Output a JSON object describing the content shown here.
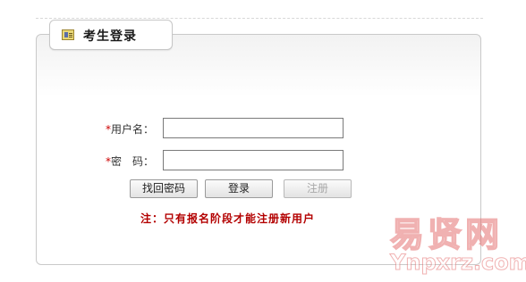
{
  "header": {
    "title": "考生登录",
    "icon": "id-card-icon"
  },
  "form": {
    "username": {
      "required_mark": "*",
      "label": "用户名：",
      "value": ""
    },
    "password": {
      "required_mark": "*",
      "label": "密　码：",
      "value": ""
    }
  },
  "buttons": {
    "recover_password": "找回密码",
    "login": "登录",
    "register": "注册"
  },
  "note": "注：只有报名阶段才能注册新用户",
  "watermark": {
    "cn": "易贤网",
    "en": "Ynpxrz.com"
  },
  "colors": {
    "required": "#cc0000",
    "note": "#b30000",
    "watermark": "#e57373"
  }
}
